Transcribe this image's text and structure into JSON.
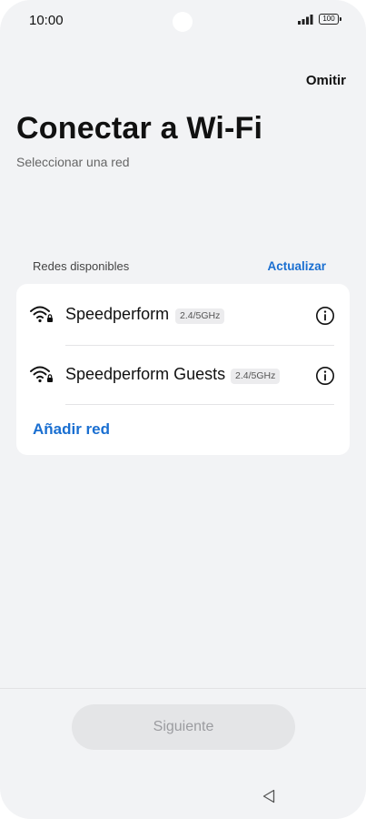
{
  "status_bar": {
    "time": "10:00",
    "battery": "100",
    "icons": [
      "signal-icon",
      "battery-icon"
    ]
  },
  "header": {
    "skip_label": "Omitir",
    "title": "Conectar a Wi-Fi",
    "subtitle": "Seleccionar una red"
  },
  "networks_section": {
    "label": "Redes disponibles",
    "refresh_label": "Actualizar",
    "networks": [
      {
        "name": "Speedperform",
        "band": "2.4/5GHz",
        "icon": "wifi-locked-icon"
      },
      {
        "name": "Speedperform Guests",
        "band": "2.4/5GHz",
        "icon": "wifi-locked-icon"
      }
    ],
    "add_network_label": "Añadir red"
  },
  "footer": {
    "next_label": "Siguiente",
    "next_enabled": false
  },
  "colors": {
    "accent": "#1a6fd1",
    "background": "#f2f3f5",
    "card": "#ffffff",
    "disabled_button": "#e4e5e7"
  }
}
